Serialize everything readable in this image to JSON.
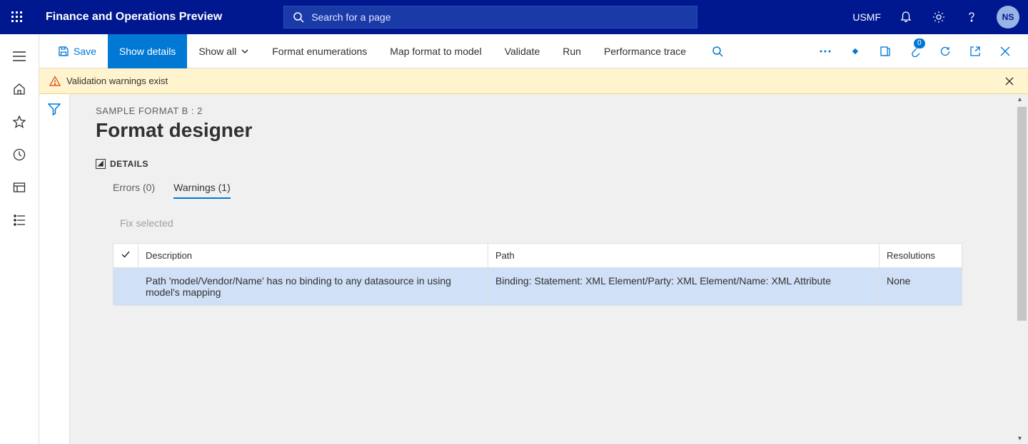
{
  "topbar": {
    "app_title": "Finance and Operations Preview",
    "search_placeholder": "Search for a page",
    "company": "USMF",
    "avatar_initials": "NS"
  },
  "actionbar": {
    "save": "Save",
    "show_details": "Show details",
    "show_all": "Show all",
    "format_enum": "Format enumerations",
    "map_format": "Map format to model",
    "validate": "Validate",
    "run": "Run",
    "perf_trace": "Performance trace",
    "attach_badge": "0"
  },
  "warnbanner": {
    "message": "Validation warnings exist"
  },
  "page": {
    "breadcrumb": "SAMPLE FORMAT B : 2",
    "title": "Format designer",
    "details_label": "DETAILS"
  },
  "tabs": {
    "errors": "Errors (0)",
    "warnings": "Warnings (1)",
    "errors_count": 0,
    "warnings_count": 1
  },
  "gridbar": {
    "fix_selected": "Fix selected"
  },
  "grid": {
    "col_desc": "Description",
    "col_path": "Path",
    "col_res": "Resolutions",
    "row0_desc": "Path 'model/Vendor/Name' has no binding to any datasource in using model's mapping",
    "row0_path": "Binding: Statement: XML Element/Party: XML Element/Name: XML Attribute",
    "row0_res": "None"
  }
}
